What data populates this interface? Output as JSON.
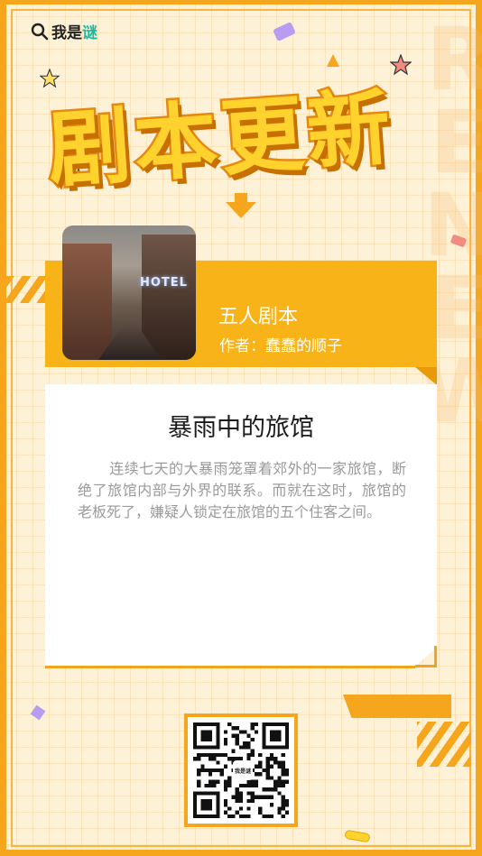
{
  "brand": {
    "logo_text": "我是",
    "logo_accent": "谜"
  },
  "header": {
    "title": "剧本更新",
    "watermark": "RENEW"
  },
  "script": {
    "category": "五人剧本",
    "author_label": "作者：",
    "author_name": "蠢蠢的顺子",
    "photo_sign": "HOTEL"
  },
  "story": {
    "title": "暴雨中的旅馆",
    "body": "连续七天的大暴雨笼罩着郊外的一家旅馆，断绝了旅馆内部与外界的联系。而就在这时，旅馆的老板死了，嫌疑人锁定在旅馆的五个住客之间。"
  },
  "qr": {
    "center_text": "我是谜"
  },
  "colors": {
    "accent": "#f6a61d",
    "band": "#f7b317",
    "background": "#fdf1d8",
    "logo_accent": "#1fb7a0"
  }
}
